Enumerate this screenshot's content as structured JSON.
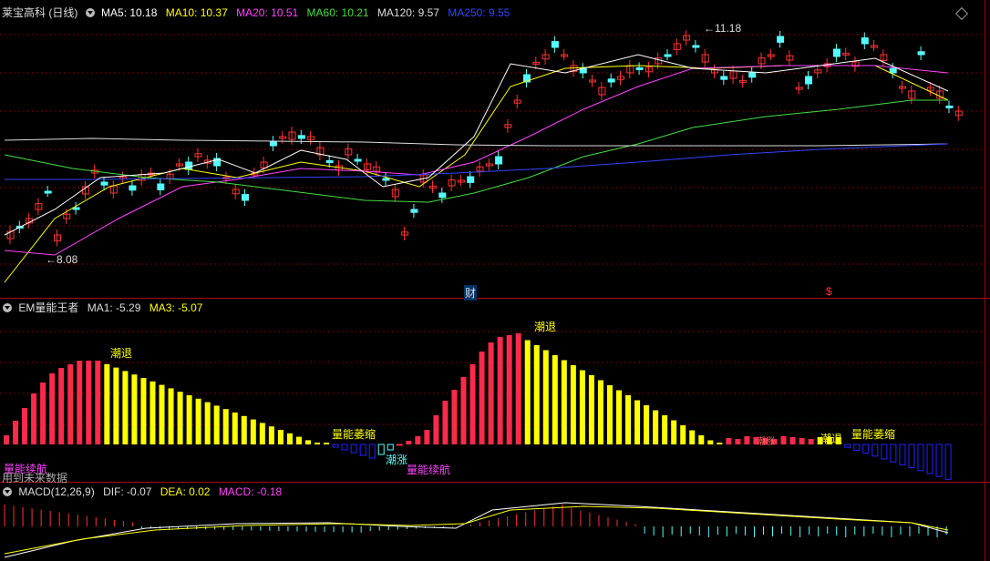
{
  "main_panel": {
    "title": "莱宝高科 (日线)",
    "indicators": [
      {
        "label": "MA5: 10.18",
        "color": "#ffffff"
      },
      {
        "label": "MA10: 10.37",
        "color": "#ffff00"
      },
      {
        "label": "MA20: 10.51",
        "color": "#ff44ff"
      },
      {
        "label": "MA60: 10.21",
        "color": "#44dd44"
      },
      {
        "label": "MA120: 9.57",
        "color": "#dddddd"
      },
      {
        "label": "MA250: 9.55",
        "color": "#3333ff"
      }
    ],
    "high_marker": "11.18",
    "low_marker": "8.08",
    "event_cai": "财",
    "event_dollar": "$"
  },
  "em_panel": {
    "title": "EM量能王者",
    "ma1": "MA1: -5.29",
    "ma3": "MA3: -5.07",
    "labels": {
      "chaotui1": "潮退",
      "chaotui2": "潮退",
      "chaotui3": "潮退",
      "liangneng_weisuo1": "量能萎缩",
      "liangneng_weisuo2": "量能萎缩",
      "liangneng_xuhang1": "量能续航",
      "liangneng_xuhang2": "量能续航",
      "chaozhang": "潮涨",
      "chaozhang2": "潮涨",
      "future_note": "用到未来数据"
    }
  },
  "macd_panel": {
    "title": "MACD(12,26,9)",
    "dif": "DIF: -0.07",
    "dea": "DEA: 0.02",
    "macd": "MACD: -0.18"
  },
  "colors": {
    "up": "#ff3333",
    "down": "#54ffff",
    "bar_red": "#ff2a4a",
    "bar_yellow": "#ffff00",
    "bar_blue": "#2222ff",
    "grid": "#7a0000"
  }
}
